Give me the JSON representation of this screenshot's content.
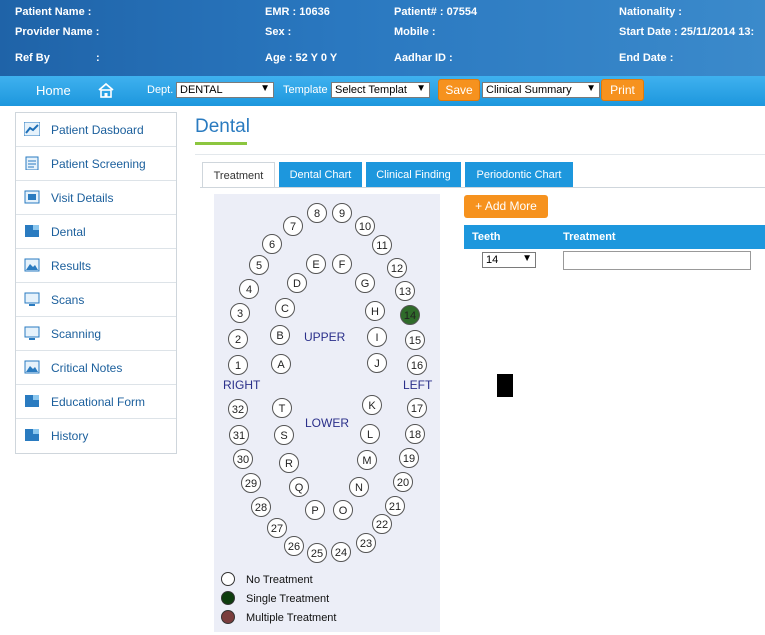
{
  "patient_header": {
    "patient_name": "Patient Name   :",
    "provider_name": "Provider Name :",
    "ref_by": "Ref By",
    "ref_by_colon": ":",
    "emr": "EMR : 10636",
    "sex": "Sex       :",
    "age": "Age  : 52 Y 0 Y",
    "patient_no": "Patient#   : 07554",
    "mobile": "Mobile     :",
    "aadhar": "Aadhar ID :",
    "nationality": "Nationality :",
    "start_date": "Start Date   : 25/11/2014 13:",
    "end_date": "End Date     :"
  },
  "nav": {
    "home": "Home",
    "dept_label": "Dept.",
    "dept_value": "DENTAL",
    "template_label": "Template",
    "template_value": "Select Templat",
    "save": "Save",
    "summary_value": "Clinical Summary",
    "print": "Print"
  },
  "sidebar": {
    "items": [
      {
        "label": "Patient Dasboard",
        "icon": "chart-line-icon"
      },
      {
        "label": "Patient Screening",
        "icon": "clipboard-icon"
      },
      {
        "label": "Visit Details",
        "icon": "visit-icon"
      },
      {
        "label": "Dental",
        "icon": "document-icon"
      },
      {
        "label": "Results",
        "icon": "image-icon"
      },
      {
        "label": "Scans",
        "icon": "monitor-icon"
      },
      {
        "label": "Scanning",
        "icon": "monitor-icon"
      },
      {
        "label": "Critical Notes",
        "icon": "image-icon"
      },
      {
        "label": "Educational Form",
        "icon": "document-icon"
      },
      {
        "label": "History",
        "icon": "document-icon"
      }
    ]
  },
  "page": {
    "title": "Dental"
  },
  "tabs": [
    "Treatment",
    "Dental Chart",
    "Clinical Finding",
    "Periodontic Chart"
  ],
  "dental_chart": {
    "upper_label": "UPPER",
    "lower_label": "LOWER",
    "right_label": "RIGHT",
    "left_label": "LEFT",
    "selected_tooth": "14",
    "colors": {
      "selected": "#2f6b2a",
      "tooth_fill": "#ffffff",
      "tooth_stroke": "#555555",
      "label": "#2a2f8a"
    },
    "legend": [
      {
        "label": "No Treatment",
        "color": "#ffffff"
      },
      {
        "label": "Single Treatment",
        "color": "#0e3d0e"
      },
      {
        "label": "Multiple Treatment",
        "color": "#7a3d3d"
      }
    ]
  },
  "treatment": {
    "add_more": "+ Add More",
    "col_teeth": "Teeth",
    "col_treatment": "Treatment",
    "teeth_value": "14",
    "treatment_value": ""
  },
  "colors": {
    "header_blue": "#1f63a8",
    "nav_blue": "#1d97dd",
    "accent_orange": "#f6921e",
    "title_blue": "#2a7bc0",
    "title_underline": "#8cc63f"
  }
}
